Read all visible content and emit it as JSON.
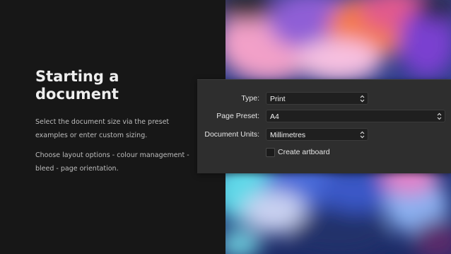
{
  "intro": {
    "title": "Starting a document",
    "paragraph_1": "Select the document size via the preset examples or enter custom sizing.",
    "paragraph_2": "Choose layout options - colour management - bleed - page orientation."
  },
  "dialog": {
    "type": {
      "label": "Type:",
      "value": "Print"
    },
    "page_preset": {
      "label": "Page Preset:",
      "value": "A4"
    },
    "document_units": {
      "label": "Document Units:",
      "value": "Millimetres"
    },
    "create_artboard": {
      "label": "Create artboard",
      "checked": false
    }
  },
  "colors": {
    "background": "#171717",
    "dialog_background": "#2e2e2e",
    "field_background": "#1f1f1f"
  },
  "icons": {
    "stepper": "up-down-chevron-icon"
  }
}
